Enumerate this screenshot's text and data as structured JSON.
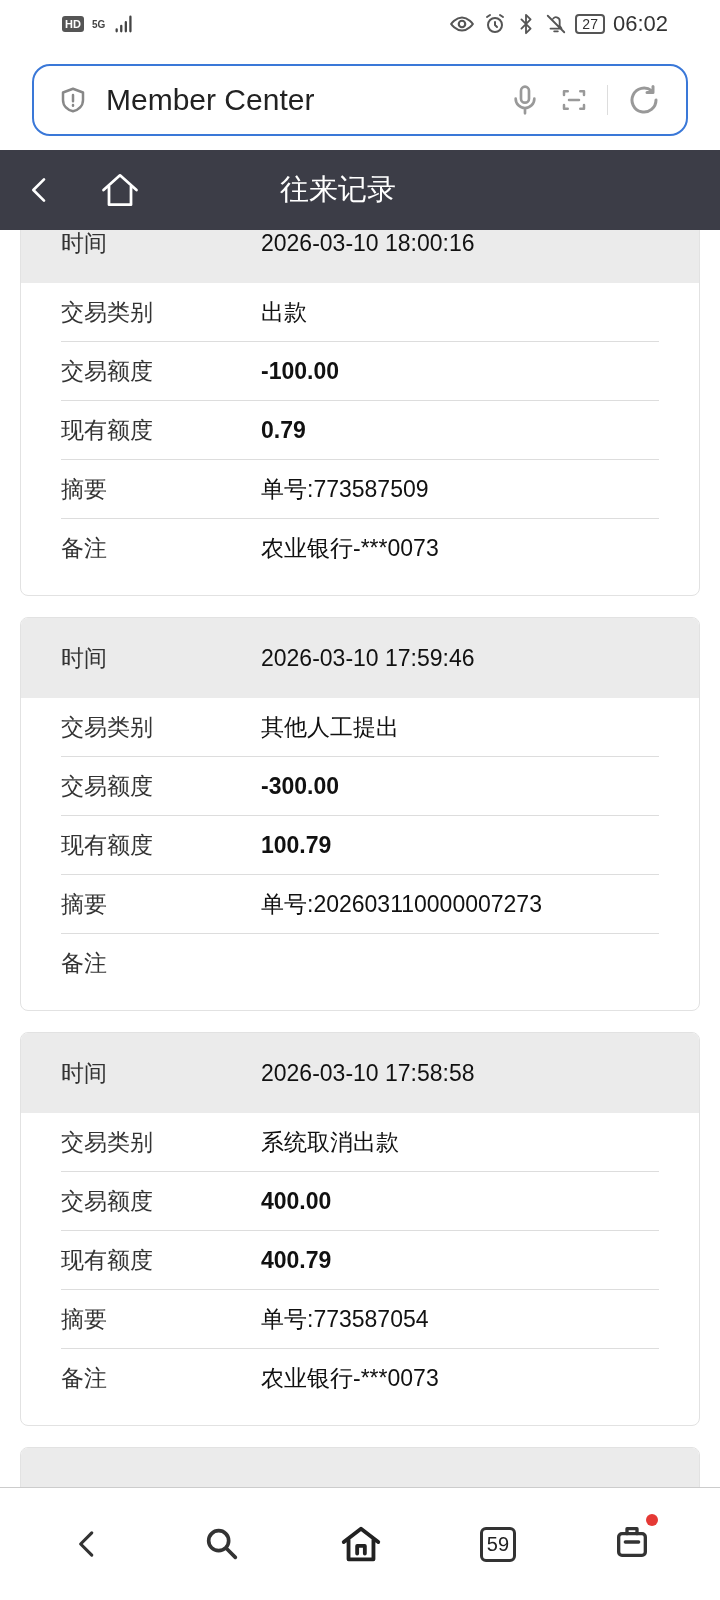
{
  "status_bar": {
    "hd": "HD",
    "network": "5G",
    "battery": "27",
    "time": "06:02"
  },
  "address_bar": {
    "title": "Member Center"
  },
  "header": {
    "title": "往来记录"
  },
  "records": [
    {
      "time_label": "时间",
      "time": "2026-03-10 18:00:16",
      "rows": [
        {
          "label": "交易类别",
          "value": "出款",
          "kind": "text"
        },
        {
          "label": "交易额度",
          "value": "-100.00",
          "kind": "amount"
        },
        {
          "label": "现有额度",
          "value": "0.79",
          "kind": "amount"
        },
        {
          "label": "摘要",
          "value": "单号:773587509",
          "kind": "text"
        },
        {
          "label": "备注",
          "value": "农业银行-***0073",
          "kind": "text"
        }
      ]
    },
    {
      "time_label": "时间",
      "time": "2026-03-10 17:59:46",
      "rows": [
        {
          "label": "交易类别",
          "value": "其他人工提出",
          "kind": "text"
        },
        {
          "label": "交易额度",
          "value": "-300.00",
          "kind": "amount"
        },
        {
          "label": "现有额度",
          "value": "100.79",
          "kind": "amount"
        },
        {
          "label": "摘要",
          "value": "单号:202603110000007273",
          "kind": "text"
        },
        {
          "label": "备注"
        }
      ]
    },
    {
      "time_label": "时间",
      "time": "2026-03-10 17:58:58",
      "rows": [
        {
          "label": "交易类别",
          "value": "系统取消出款",
          "kind": "text"
        },
        {
          "label": "交易额度",
          "value": "400.00",
          "kind": "amount"
        },
        {
          "label": "现有额度",
          "value": "400.79",
          "kind": "amount"
        },
        {
          "label": "摘要",
          "value": "单号:773587054",
          "kind": "text"
        },
        {
          "label": "备注",
          "value": "农业银行-***0073",
          "kind": "text"
        }
      ]
    },
    {
      "kind": "partial"
    }
  ],
  "bottom_nav": {
    "tab_count": "59",
    "notification_dot": true
  }
}
